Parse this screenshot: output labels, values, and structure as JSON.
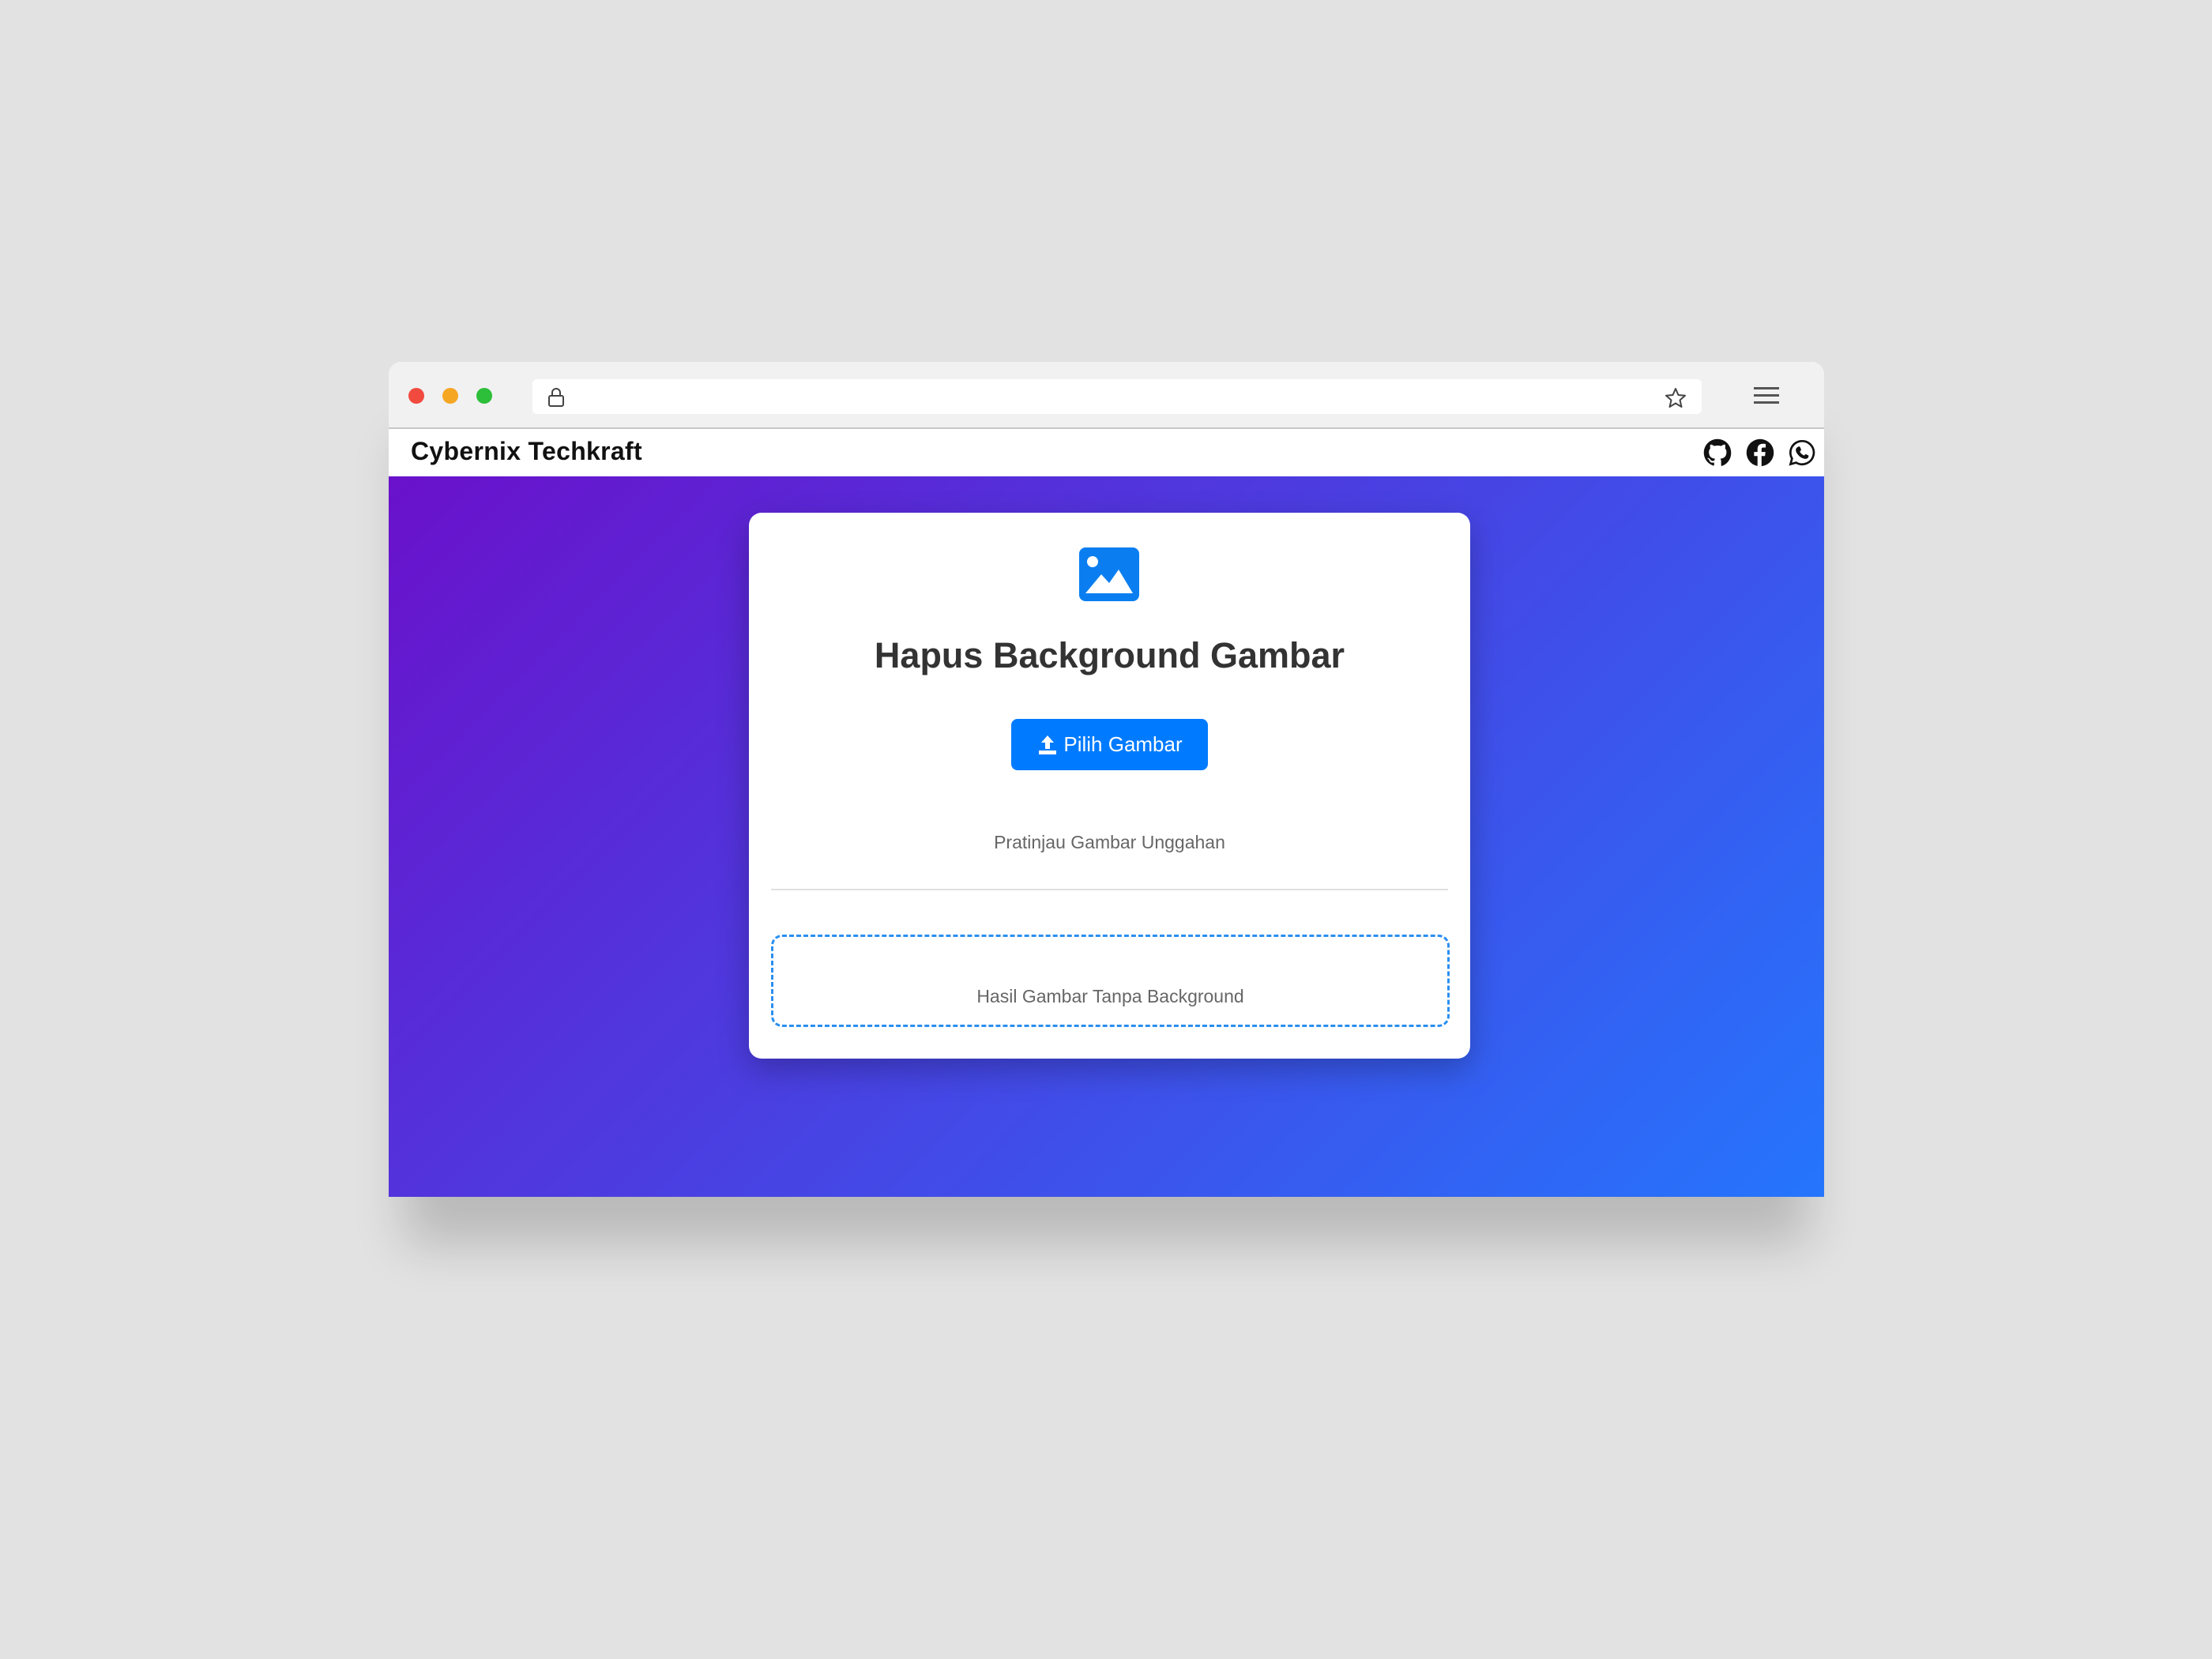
{
  "browser": {
    "url": "",
    "icons": [
      "lock-icon",
      "star-icon",
      "menu-icon"
    ]
  },
  "site": {
    "brand": "Cybernix Techkraft",
    "social_icons": [
      "github-icon",
      "facebook-icon",
      "whatsapp-icon"
    ]
  },
  "card": {
    "icon": "image-icon",
    "title": "Hapus Background Gambar",
    "upload_button_label": "Pilih Gambar",
    "preview_label": "Pratinjau Gambar Unggahan",
    "result_label": "Hasil Gambar Tanpa Background"
  },
  "colors": {
    "gradient_start": "#6a11cb",
    "gradient_end": "#2575fc",
    "accent": "#007bff",
    "dashed_border": "#2b8ff0"
  }
}
